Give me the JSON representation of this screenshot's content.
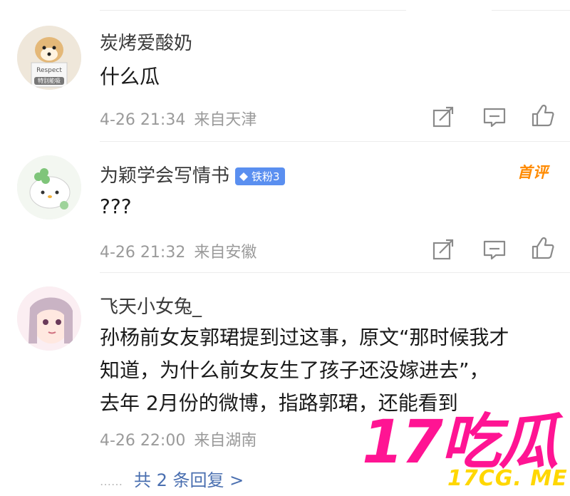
{
  "comments": [
    {
      "username": "炭烤爱酸奶",
      "text_lines": [
        "什么瓜"
      ],
      "date": "4-26 21:34",
      "location": "来自天津",
      "avatar_text": [
        "Respect",
        "特别能吸"
      ]
    },
    {
      "username": "为颖学会写情书",
      "badge": "铁粉3",
      "hot_label": "首评",
      "text_lines": [
        "???"
      ],
      "date": "4-26 21:32",
      "location": "来自安徽"
    },
    {
      "username": "飞天小女兔_",
      "text_lines": [
        "孙杨前女友郭珺提到过这事，原文“那时候我才",
        "知道，为什么前女友生了孩子还没嫁进去”，",
        "去年 2月份的微博，指路郭珺，还能看到"
      ],
      "date": "4-26 22:00",
      "location": "来自湖南"
    }
  ],
  "replies": {
    "dots": "……",
    "link": "共 2 条回复 >"
  },
  "watermark": {
    "big": "17吃瓜",
    "small": "17CG. ME"
  },
  "icons": [
    "share-icon",
    "comment-icon",
    "like-icon"
  ],
  "colors": {
    "accent_link": "#4a6fb0",
    "badge_bg": "#5a8ff0",
    "hot_label": "#ff8a00",
    "watermark_pink": "#ff1493",
    "watermark_yellow": "#ffd700"
  }
}
